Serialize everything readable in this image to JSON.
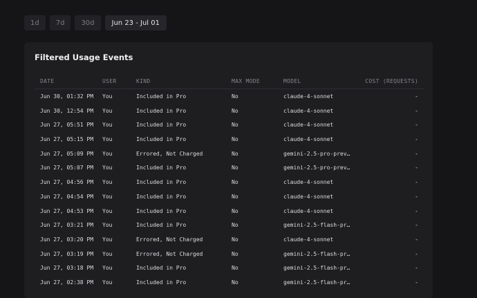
{
  "range": {
    "options": [
      "1d",
      "7d",
      "30d"
    ],
    "selected": "Jun 23 - Jul 01"
  },
  "card": {
    "title": "Filtered Usage Events"
  },
  "table": {
    "headers": {
      "date": "DATE",
      "user": "USER",
      "kind": "KIND",
      "max_mode": "MAX MODE",
      "model": "MODEL",
      "cost": "COST (REQUESTS)"
    },
    "rows": [
      {
        "date": "Jun 30, 01:32 PM",
        "user": "You",
        "kind": "Included in Pro",
        "max_mode": "No",
        "model": "claude-4-sonnet",
        "cost": "-"
      },
      {
        "date": "Jun 30, 12:54 PM",
        "user": "You",
        "kind": "Included in Pro",
        "max_mode": "No",
        "model": "claude-4-sonnet",
        "cost": "-"
      },
      {
        "date": "Jun 27, 05:51 PM",
        "user": "You",
        "kind": "Included in Pro",
        "max_mode": "No",
        "model": "claude-4-sonnet",
        "cost": "-"
      },
      {
        "date": "Jun 27, 05:15 PM",
        "user": "You",
        "kind": "Included in Pro",
        "max_mode": "No",
        "model": "claude-4-sonnet",
        "cost": "-"
      },
      {
        "date": "Jun 27, 05:09 PM",
        "user": "You",
        "kind": "Errored, Not Charged",
        "max_mode": "No",
        "model": "gemini-2.5-pro-prev…",
        "cost": "-"
      },
      {
        "date": "Jun 27, 05:07 PM",
        "user": "You",
        "kind": "Included in Pro",
        "max_mode": "No",
        "model": "gemini-2.5-pro-prev…",
        "cost": "-"
      },
      {
        "date": "Jun 27, 04:56 PM",
        "user": "You",
        "kind": "Included in Pro",
        "max_mode": "No",
        "model": "claude-4-sonnet",
        "cost": "-"
      },
      {
        "date": "Jun 27, 04:54 PM",
        "user": "You",
        "kind": "Included in Pro",
        "max_mode": "No",
        "model": "claude-4-sonnet",
        "cost": "-"
      },
      {
        "date": "Jun 27, 04:53 PM",
        "user": "You",
        "kind": "Included in Pro",
        "max_mode": "No",
        "model": "claude-4-sonnet",
        "cost": "-"
      },
      {
        "date": "Jun 27, 03:21 PM",
        "user": "You",
        "kind": "Included in Pro",
        "max_mode": "No",
        "model": "gemini-2.5-flash-pr…",
        "cost": "-"
      },
      {
        "date": "Jun 27, 03:20 PM",
        "user": "You",
        "kind": "Errored, Not Charged",
        "max_mode": "No",
        "model": "claude-4-sonnet",
        "cost": "-"
      },
      {
        "date": "Jun 27, 03:19 PM",
        "user": "You",
        "kind": "Errored, Not Charged",
        "max_mode": "No",
        "model": "gemini-2.5-flash-pr…",
        "cost": "-"
      },
      {
        "date": "Jun 27, 03:18 PM",
        "user": "You",
        "kind": "Included in Pro",
        "max_mode": "No",
        "model": "gemini-2.5-flash-pr…",
        "cost": "-"
      },
      {
        "date": "Jun 27, 02:38 PM",
        "user": "You",
        "kind": "Included in Pro",
        "max_mode": "No",
        "model": "gemini-2.5-flash-pr…",
        "cost": "-"
      }
    ]
  }
}
